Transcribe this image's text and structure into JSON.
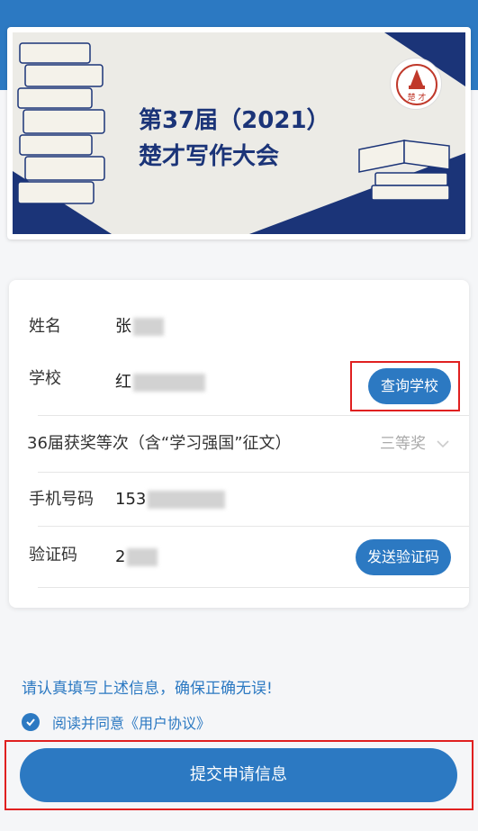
{
  "banner": {
    "title_line1": "第37届（2021）",
    "title_line2": "楚才写作大会",
    "logo_text": "楚 才"
  },
  "form": {
    "name": {
      "label": "姓名",
      "value": "张"
    },
    "school": {
      "label": "学校",
      "value": "红",
      "button": "查询学校"
    },
    "award": {
      "label": "36届获奖等次（含“学习强国”征文）",
      "value": "三等奖"
    },
    "phone": {
      "label": "手机号码",
      "value": "153"
    },
    "code": {
      "label": "验证码",
      "value": "2",
      "button": "发送验证码"
    }
  },
  "notice": "请认真填写上述信息，确保正确无误!",
  "agreement": {
    "text": "阅读并同意《用户协议》",
    "checked": true
  },
  "submit_label": "提交申请信息",
  "colors": {
    "primary": "#2c79c2",
    "highlight": "#e02020",
    "banner_navy": "#1b3478"
  }
}
